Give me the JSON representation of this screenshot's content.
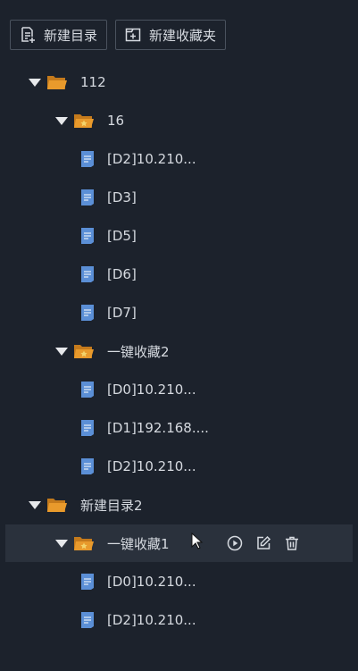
{
  "toolbar": {
    "new_dir_label": "新建目录",
    "new_fav_label": "新建收藏夹"
  },
  "tree": [
    {
      "level": 0,
      "type": "folder",
      "label": "112"
    },
    {
      "level": 1,
      "type": "fav-folder",
      "label": "16"
    },
    {
      "level": 2,
      "type": "file",
      "label": "[D2]10.210..."
    },
    {
      "level": 2,
      "type": "file",
      "label": "[D3]"
    },
    {
      "level": 2,
      "type": "file",
      "label": "[D5]"
    },
    {
      "level": 2,
      "type": "file",
      "label": "[D6]"
    },
    {
      "level": 2,
      "type": "file",
      "label": "[D7]"
    },
    {
      "level": 1,
      "type": "fav-folder",
      "label": "一键收藏2"
    },
    {
      "level": 2,
      "type": "file",
      "label": "[D0]10.210..."
    },
    {
      "level": 2,
      "type": "file",
      "label": "[D1]192.168...."
    },
    {
      "level": 2,
      "type": "file",
      "label": "[D2]10.210..."
    },
    {
      "level": 0,
      "type": "folder",
      "label": "新建目录2"
    },
    {
      "level": 1,
      "type": "fav-folder",
      "label": "一键收藏1",
      "highlighted": true
    },
    {
      "level": 2,
      "type": "file",
      "label": "[D0]10.210..."
    },
    {
      "level": 2,
      "type": "file",
      "label": "[D2]10.210..."
    }
  ],
  "colors": {
    "background": "#1c222c",
    "row_highlight": "#2a313c",
    "folder": "#e89a2c",
    "fav_star": "#f3d36b",
    "file": "#5b8fd6",
    "text": "#d6dae0"
  }
}
